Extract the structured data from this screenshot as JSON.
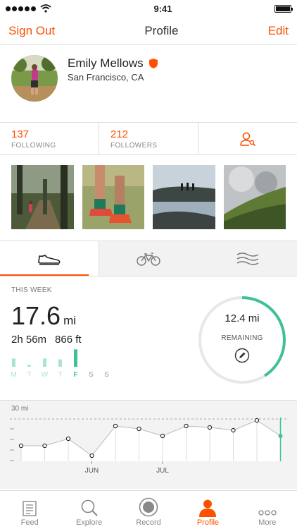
{
  "status_bar": {
    "time": "9:41"
  },
  "nav": {
    "left": "Sign Out",
    "title": "Profile",
    "right": "Edit"
  },
  "profile": {
    "name": "Emily Mellows",
    "location": "San Francisco, CA"
  },
  "follow": {
    "following_count": "137",
    "following_label": "FOLLOWING",
    "followers_count": "212",
    "followers_label": "FOLLOWERS"
  },
  "colors": {
    "accent": "#fc5200",
    "ring": "#3ec19a",
    "bar_active": "#3ec19a",
    "bar": "#a9e4d1"
  },
  "this_week": {
    "label": "THIS WEEK",
    "distance": "17.6",
    "unit": "mi",
    "time": "2h 56m",
    "elevation": "866 ft",
    "remaining_value": "12.4 mi",
    "remaining_label": "REMAINING",
    "remaining_fraction": 0.41,
    "days": [
      "M",
      "T",
      "W",
      "T",
      "F",
      "S",
      "S"
    ],
    "day_levels": [
      0.45,
      0.1,
      0.45,
      0.4,
      0.95,
      0,
      0
    ]
  },
  "chart_data": {
    "type": "line",
    "ylabel": "30 mi",
    "x_labels": [
      "JUN",
      "JUL"
    ],
    "values": [
      11,
      11,
      16,
      4,
      25,
      23,
      18,
      25,
      24,
      22,
      29,
      18
    ]
  },
  "tabbar": {
    "items": [
      {
        "label": "Feed",
        "icon": "feed-icon"
      },
      {
        "label": "Explore",
        "icon": "search-icon"
      },
      {
        "label": "Record",
        "icon": "record-icon"
      },
      {
        "label": "Profile",
        "icon": "profile-icon"
      },
      {
        "label": "More",
        "icon": "more-icon"
      }
    ]
  }
}
